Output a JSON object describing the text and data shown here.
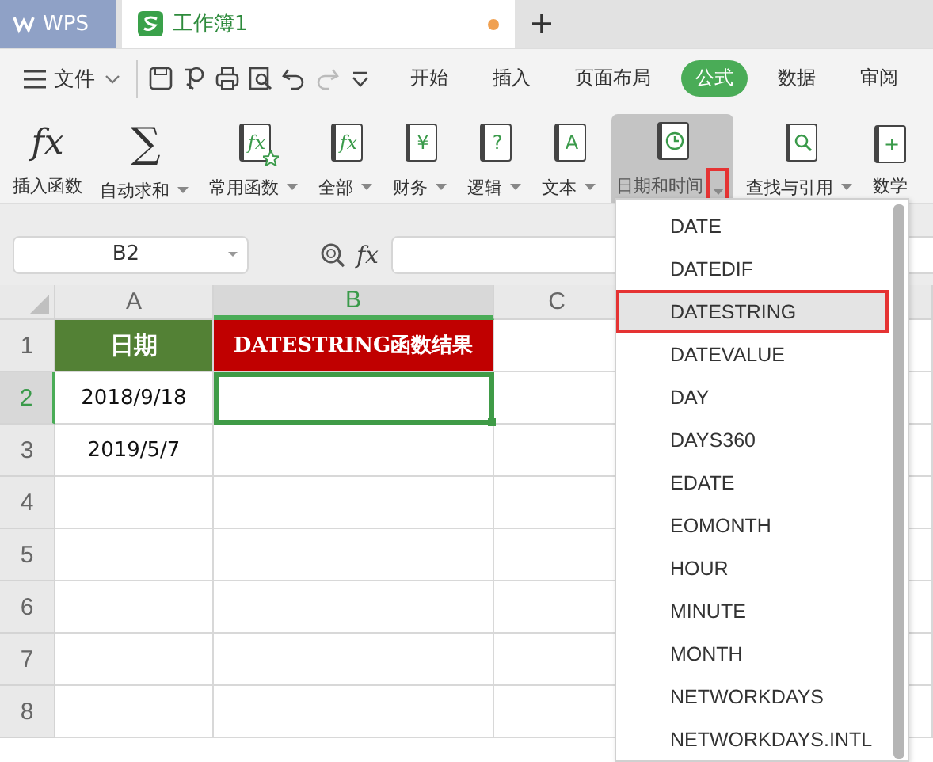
{
  "app_tab": {
    "label": "WPS"
  },
  "document_tab": {
    "title": "工作簿1",
    "unsaved": true
  },
  "menu": {
    "file_label": "文件",
    "quick_tools": [
      {
        "kind": "save",
        "disabled": false
      },
      {
        "kind": "painter",
        "disabled": false
      },
      {
        "kind": "print",
        "disabled": false
      },
      {
        "kind": "preview",
        "disabled": false
      },
      {
        "kind": "undo",
        "disabled": false
      },
      {
        "kind": "redo",
        "disabled": true
      },
      {
        "kind": "more",
        "disabled": false
      }
    ],
    "tabs": [
      {
        "label": "开始",
        "selected": false
      },
      {
        "label": "插入",
        "selected": false
      },
      {
        "label": "页面布局",
        "selected": false
      },
      {
        "label": "公式",
        "selected": true
      },
      {
        "label": "数据",
        "selected": false
      },
      {
        "label": "审阅",
        "selected": false
      }
    ]
  },
  "ribbon": {
    "buttons": [
      {
        "kind": "glyph",
        "mark": "fx",
        "label": "插入函数",
        "has_menu": false,
        "selected": false
      },
      {
        "kind": "glyph",
        "mark": "∑",
        "label": "自动求和",
        "has_menu": true,
        "selected": false,
        "caret_highlighted": false
      },
      {
        "kind": "book-star",
        "mark": "fx",
        "label": "常用函数",
        "has_menu": true,
        "selected": false,
        "caret_highlighted": false
      },
      {
        "kind": "book",
        "mark": "fx",
        "label": "全部",
        "has_menu": true,
        "selected": false,
        "caret_highlighted": false
      },
      {
        "kind": "book",
        "mark": "¥",
        "label": "财务",
        "has_menu": true,
        "selected": false,
        "caret_highlighted": false
      },
      {
        "kind": "book",
        "mark": "?",
        "label": "逻辑",
        "has_menu": true,
        "selected": false,
        "caret_highlighted": false
      },
      {
        "kind": "book",
        "mark": "A",
        "label": "文本",
        "has_menu": true,
        "selected": false,
        "caret_highlighted": false
      },
      {
        "kind": "book-clock",
        "label": "日期和时间",
        "has_menu": true,
        "selected": true,
        "caret_highlighted": true
      },
      {
        "kind": "book-search",
        "label": "查找与引用",
        "has_menu": true,
        "selected": false,
        "caret_highlighted": false
      },
      {
        "kind": "book",
        "mark": "+",
        "label": "数学",
        "has_menu": false,
        "selected": false
      }
    ]
  },
  "formula_bar": {
    "name_box": "B2",
    "fx": "fx"
  },
  "sheet": {
    "columns": [
      {
        "label": "A",
        "selected": false
      },
      {
        "label": "B",
        "selected": true
      },
      {
        "label": "C",
        "selected": false
      }
    ],
    "rows": [
      {
        "label": "1",
        "selected": false,
        "cells": [
          {
            "kind": "green-header",
            "text": "日期"
          },
          {
            "kind": "red-header",
            "text": "DATESTRING函数结果"
          },
          {
            "kind": "plain"
          }
        ]
      },
      {
        "label": "2",
        "selected": true,
        "cells": [
          {
            "kind": "plain",
            "text": "2018/9/18"
          },
          {
            "kind": "plain",
            "active": true
          },
          {
            "kind": "plain"
          }
        ]
      },
      {
        "label": "3",
        "selected": false,
        "cells": [
          {
            "kind": "plain",
            "text": "2019/5/7"
          },
          {
            "kind": "plain"
          },
          {
            "kind": "plain"
          }
        ]
      },
      {
        "label": "4",
        "selected": false,
        "cells": [
          {
            "kind": "plain"
          },
          {
            "kind": "plain"
          },
          {
            "kind": "plain"
          }
        ]
      },
      {
        "label": "5",
        "selected": false,
        "cells": [
          {
            "kind": "plain"
          },
          {
            "kind": "plain"
          },
          {
            "kind": "plain"
          }
        ]
      },
      {
        "label": "6",
        "selected": false,
        "cells": [
          {
            "kind": "plain"
          },
          {
            "kind": "plain"
          },
          {
            "kind": "plain"
          }
        ]
      },
      {
        "label": "7",
        "selected": false,
        "cells": [
          {
            "kind": "plain"
          },
          {
            "kind": "plain"
          },
          {
            "kind": "plain"
          }
        ]
      },
      {
        "label": "8",
        "selected": false,
        "cells": [
          {
            "kind": "plain"
          },
          {
            "kind": "plain"
          },
          {
            "kind": "plain"
          }
        ]
      }
    ]
  },
  "dropdown": {
    "items": [
      {
        "label": "DATE",
        "selected": false
      },
      {
        "label": "DATEDIF",
        "selected": false
      },
      {
        "label": "DATESTRING",
        "selected": true
      },
      {
        "label": "DATEVALUE",
        "selected": false
      },
      {
        "label": "DAY",
        "selected": false
      },
      {
        "label": "DAYS360",
        "selected": false
      },
      {
        "label": "EDATE",
        "selected": false
      },
      {
        "label": "EOMONTH",
        "selected": false
      },
      {
        "label": "HOUR",
        "selected": false
      },
      {
        "label": "MINUTE",
        "selected": false
      },
      {
        "label": "MONTH",
        "selected": false
      },
      {
        "label": "NETWORKDAYS",
        "selected": false
      },
      {
        "label": "NETWORKDAYS.INTL",
        "selected": false
      }
    ]
  }
}
